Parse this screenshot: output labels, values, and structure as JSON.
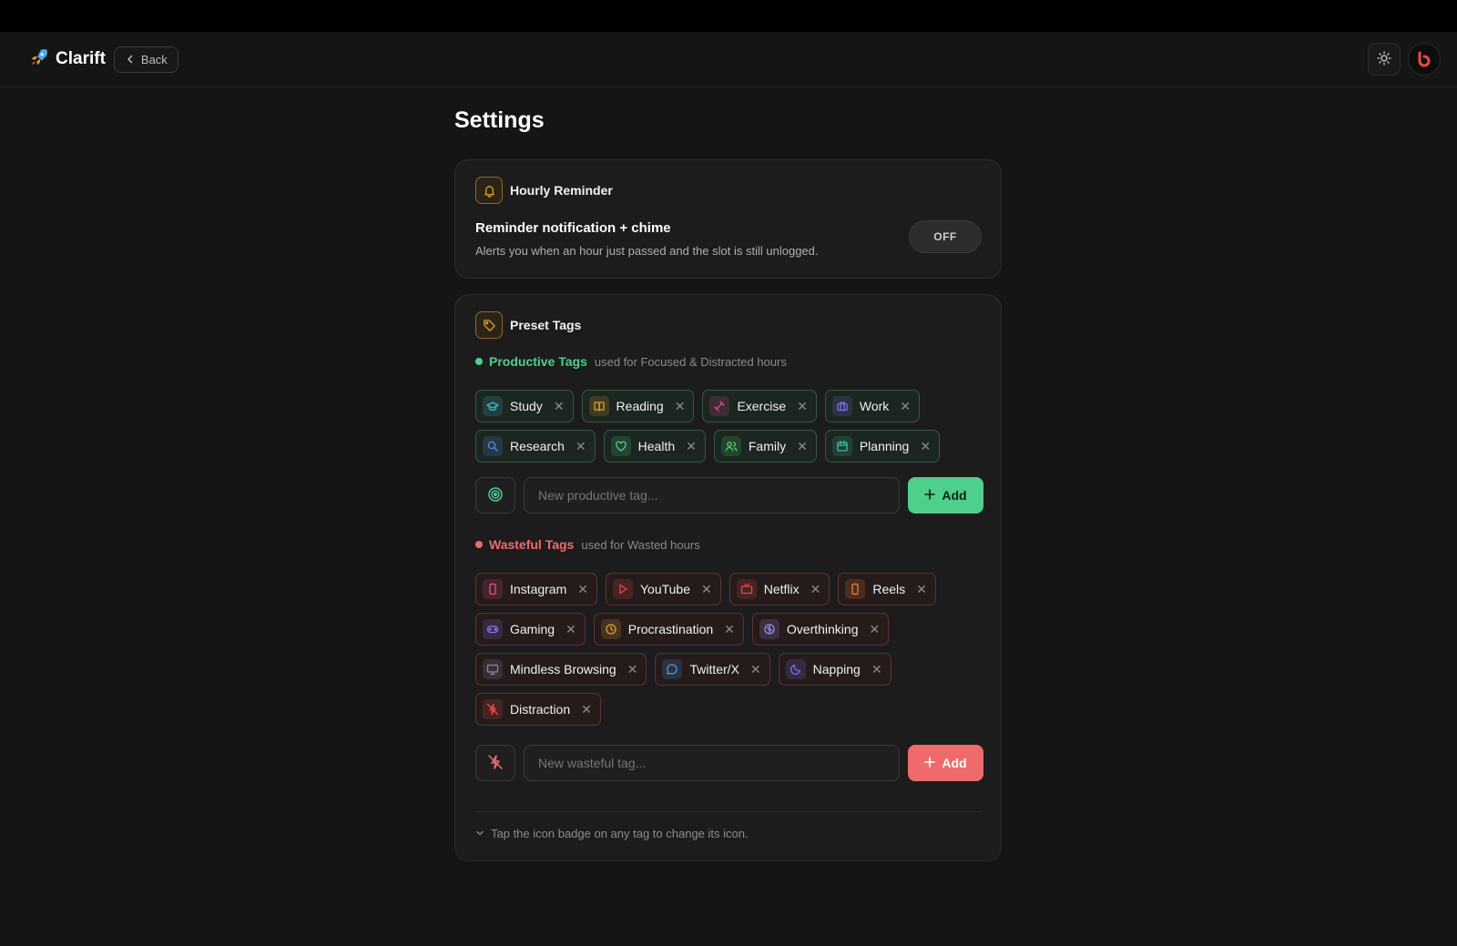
{
  "app": {
    "name": "Clarift"
  },
  "header": {
    "back_label": "Back"
  },
  "page": {
    "title": "Settings"
  },
  "reminder": {
    "section_title": "Hourly Reminder",
    "title": "Reminder notification + chime",
    "description": "Alerts you when an hour just passed and the slot is still unlogged.",
    "toggle_label": "OFF"
  },
  "tags": {
    "section_title": "Preset Tags",
    "productive": {
      "label": "Productive Tags",
      "sublabel": "used for Focused & Distracted hours",
      "color": "#4fcf8c",
      "input_placeholder": "New productive tag...",
      "add_label": "Add",
      "items": [
        {
          "label": "Study",
          "icon": "graduation-cap-icon",
          "color": "#3fb8c9"
        },
        {
          "label": "Reading",
          "icon": "book-icon",
          "color": "#e0a030"
        },
        {
          "label": "Exercise",
          "icon": "dumbbell-icon",
          "color": "#e0508a"
        },
        {
          "label": "Work",
          "icon": "briefcase-icon",
          "color": "#7a70e8"
        },
        {
          "label": "Research",
          "icon": "search-icon",
          "color": "#5a8ae8"
        },
        {
          "label": "Health",
          "icon": "heart-icon",
          "color": "#4fcf8c"
        },
        {
          "label": "Family",
          "icon": "users-icon",
          "color": "#4fcf6a"
        },
        {
          "label": "Planning",
          "icon": "calendar-icon",
          "color": "#3fc0a0"
        }
      ]
    },
    "wasteful": {
      "label": "Wasteful Tags",
      "sublabel": "used for Wasted hours",
      "color": "#ef6b6b",
      "input_placeholder": "New wasteful tag...",
      "add_label": "Add",
      "items": [
        {
          "label": "Instagram",
          "icon": "phone-icon",
          "color": "#e05080"
        },
        {
          "label": "YouTube",
          "icon": "play-icon",
          "color": "#e84848"
        },
        {
          "label": "Netflix",
          "icon": "tv-icon",
          "color": "#e84848"
        },
        {
          "label": "Reels",
          "icon": "phone-icon",
          "color": "#f08030"
        },
        {
          "label": "Gaming",
          "icon": "gamepad-icon",
          "color": "#8a70e8"
        },
        {
          "label": "Procrastination",
          "icon": "clock-icon",
          "color": "#e0a030"
        },
        {
          "label": "Overthinking",
          "icon": "brain-icon",
          "color": "#9a88e8"
        },
        {
          "label": "Mindless Browsing",
          "icon": "monitor-icon",
          "color": "#8a8a9a"
        },
        {
          "label": "Twitter/X",
          "icon": "chat-bubble-icon",
          "color": "#4a9ae8"
        },
        {
          "label": "Napping",
          "icon": "moon-icon",
          "color": "#7a70e8"
        },
        {
          "label": "Distraction",
          "icon": "zap-off-icon",
          "color": "#e84848"
        }
      ]
    },
    "hint": "Tap the icon badge on any tag to change its icon."
  }
}
